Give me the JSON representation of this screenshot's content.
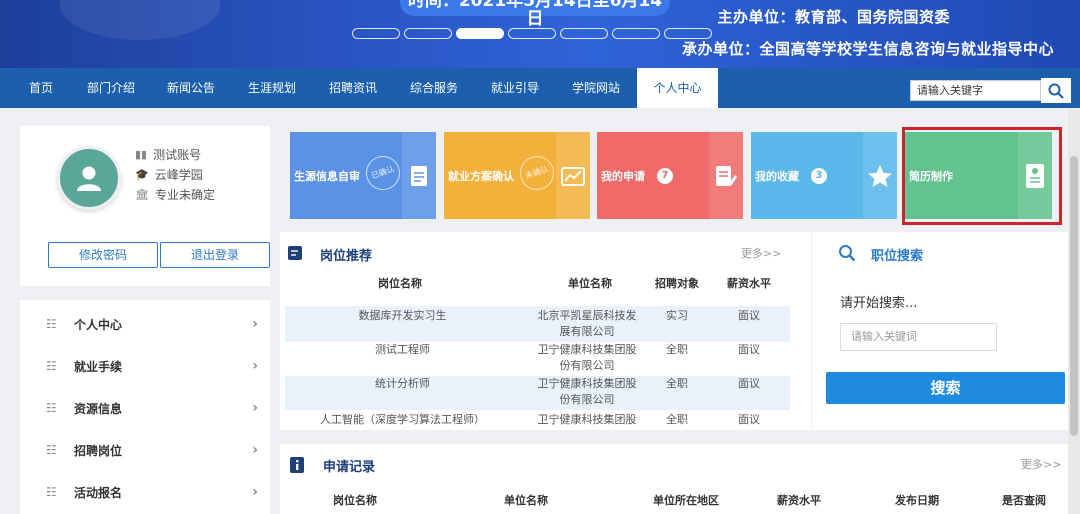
{
  "banner": {
    "date_text": "时间：2021年5月14日至6月14日",
    "organizer": "主办单位：教育部、国务院国资委",
    "co_organizer": "承办单位：全国高等学校学生信息咨询与就业指导中心",
    "slides": 7,
    "active_slide": 3
  },
  "nav": {
    "items": [
      "首页",
      "部门介绍",
      "新闻公告",
      "生涯规划",
      "招聘资讯",
      "综合服务",
      "就业引导",
      "学院网站",
      "个人中心"
    ],
    "active": "个人中心",
    "search_placeholder": "请输入关键字"
  },
  "profile": {
    "account": "测试账号",
    "school": "云峰学园",
    "major": "专业未确定",
    "change_password": "修改密码",
    "logout": "退出登录"
  },
  "menu": {
    "items": [
      "个人中心",
      "就业手续",
      "资源信息",
      "招聘岗位",
      "活动报名"
    ]
  },
  "tiles": [
    {
      "label": "生源信息自审",
      "stamp": "已确认",
      "color": "#5a93e6",
      "icon": "document-icon"
    },
    {
      "label": "就业方案确认",
      "stamp": "未确认",
      "color": "#f3b13c",
      "icon": "chart-icon"
    },
    {
      "label": "我的申请",
      "badge": "7",
      "color": "#f06a6a",
      "icon": "edit-document-icon"
    },
    {
      "label": "我的收藏",
      "badge": "3",
      "color": "#5ab8ea",
      "icon": "star-icon"
    },
    {
      "label": "简历制作",
      "color": "#62c38f",
      "icon": "resume-icon"
    }
  ],
  "jobs": {
    "title": "岗位推荐",
    "more": "更多>>",
    "headers": [
      "岗位名称",
      "单位名称",
      "招聘对象",
      "薪资水平"
    ],
    "rows": [
      {
        "name": "数据库开发实习生",
        "company_l1": "北京平凯星辰科技发",
        "company_l2": "展有限公司",
        "target": "实习",
        "salary": "面议"
      },
      {
        "name": "测试工程师",
        "company_l1": "卫宁健康科技集团股",
        "company_l2": "份有限公司",
        "target": "全职",
        "salary": "面议"
      },
      {
        "name": "统计分析师",
        "company_l1": "卫宁健康科技集团股",
        "company_l2": "份有限公司",
        "target": "全职",
        "salary": "面议"
      },
      {
        "name": "人工智能（深度学习算法工程师）",
        "company_l1": "卫宁健康科技集团股",
        "company_l2": "",
        "target": "全职",
        "salary": "面议"
      }
    ]
  },
  "job_search": {
    "title": "职位搜索",
    "hint": "请开始搜索...",
    "placeholder": "请输入关键词",
    "button": "搜索"
  },
  "applications": {
    "title": "申请记录",
    "more": "更多>>",
    "headers": [
      "岗位名称",
      "单位名称",
      "单位所在地区",
      "薪资水平",
      "发布日期",
      "是否查阅"
    ]
  }
}
